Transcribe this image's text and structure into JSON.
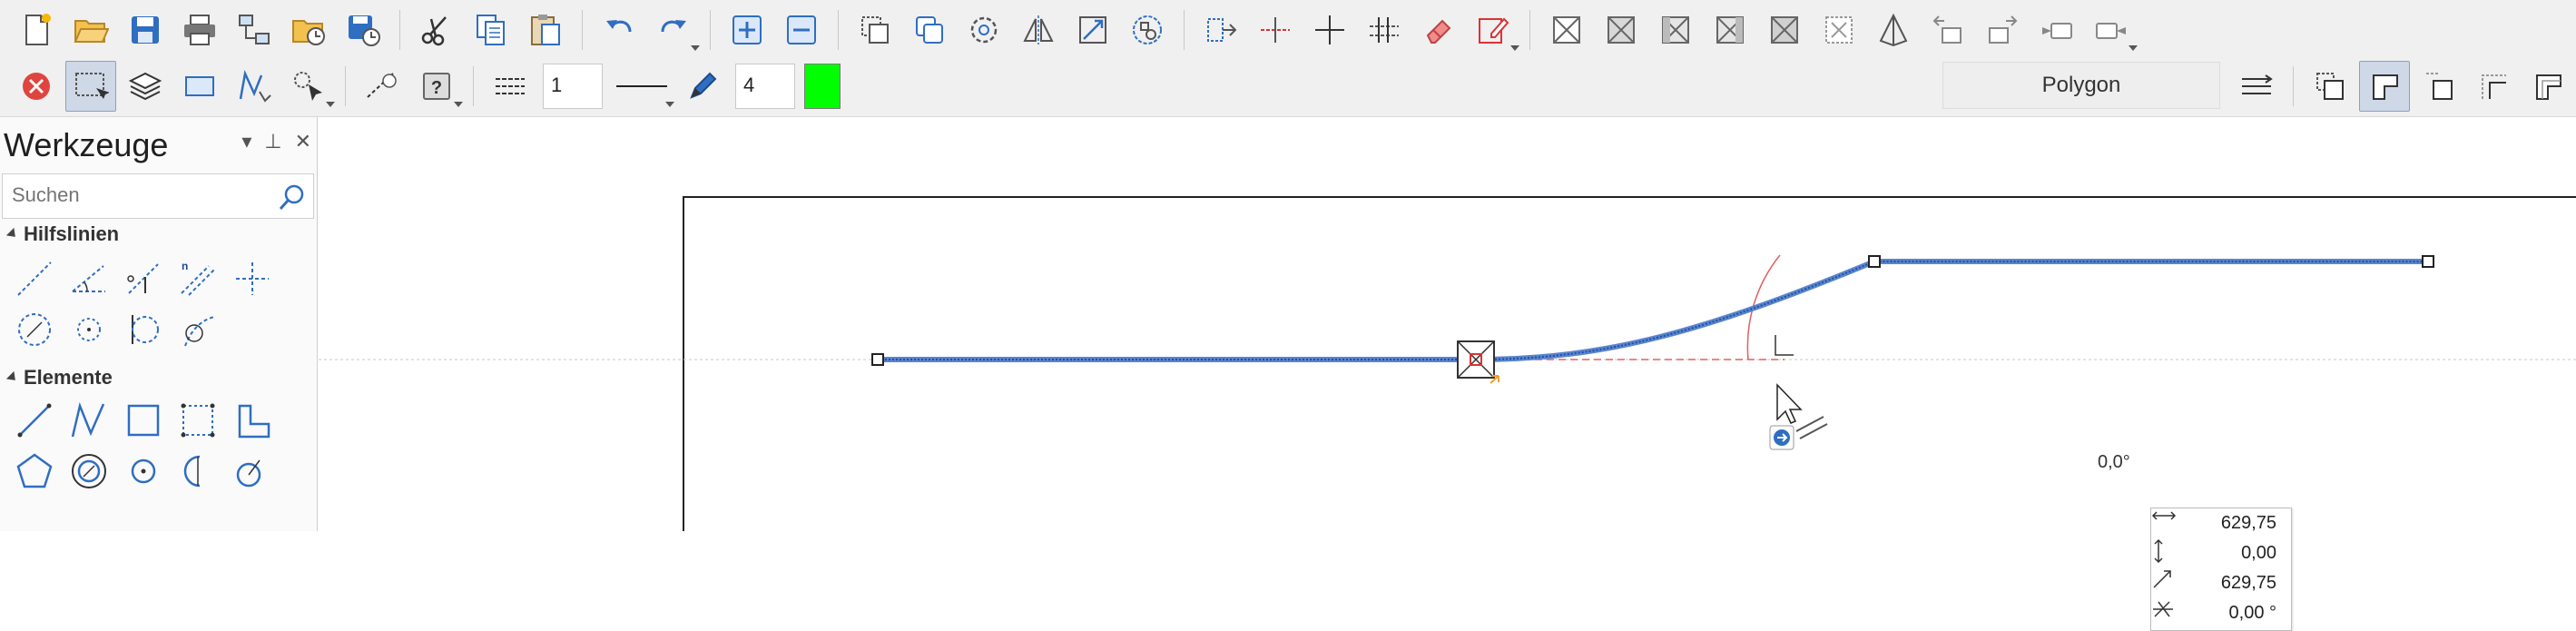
{
  "toolbar": {
    "line_width_value": "1",
    "pen_value": "4",
    "pen_color": "#00ff00",
    "mode_dropdown": "Polygon"
  },
  "tools_panel": {
    "title": "Werkzeuge",
    "search_placeholder": "Suchen",
    "groups": [
      {
        "label": "Hilfslinien"
      },
      {
        "label": "Elemente"
      }
    ]
  },
  "canvas": {
    "angle_readout": "0,0°",
    "info": {
      "dx": "629,75",
      "dy": "0,00",
      "length": "629,75",
      "angle": "0,00 °"
    }
  }
}
